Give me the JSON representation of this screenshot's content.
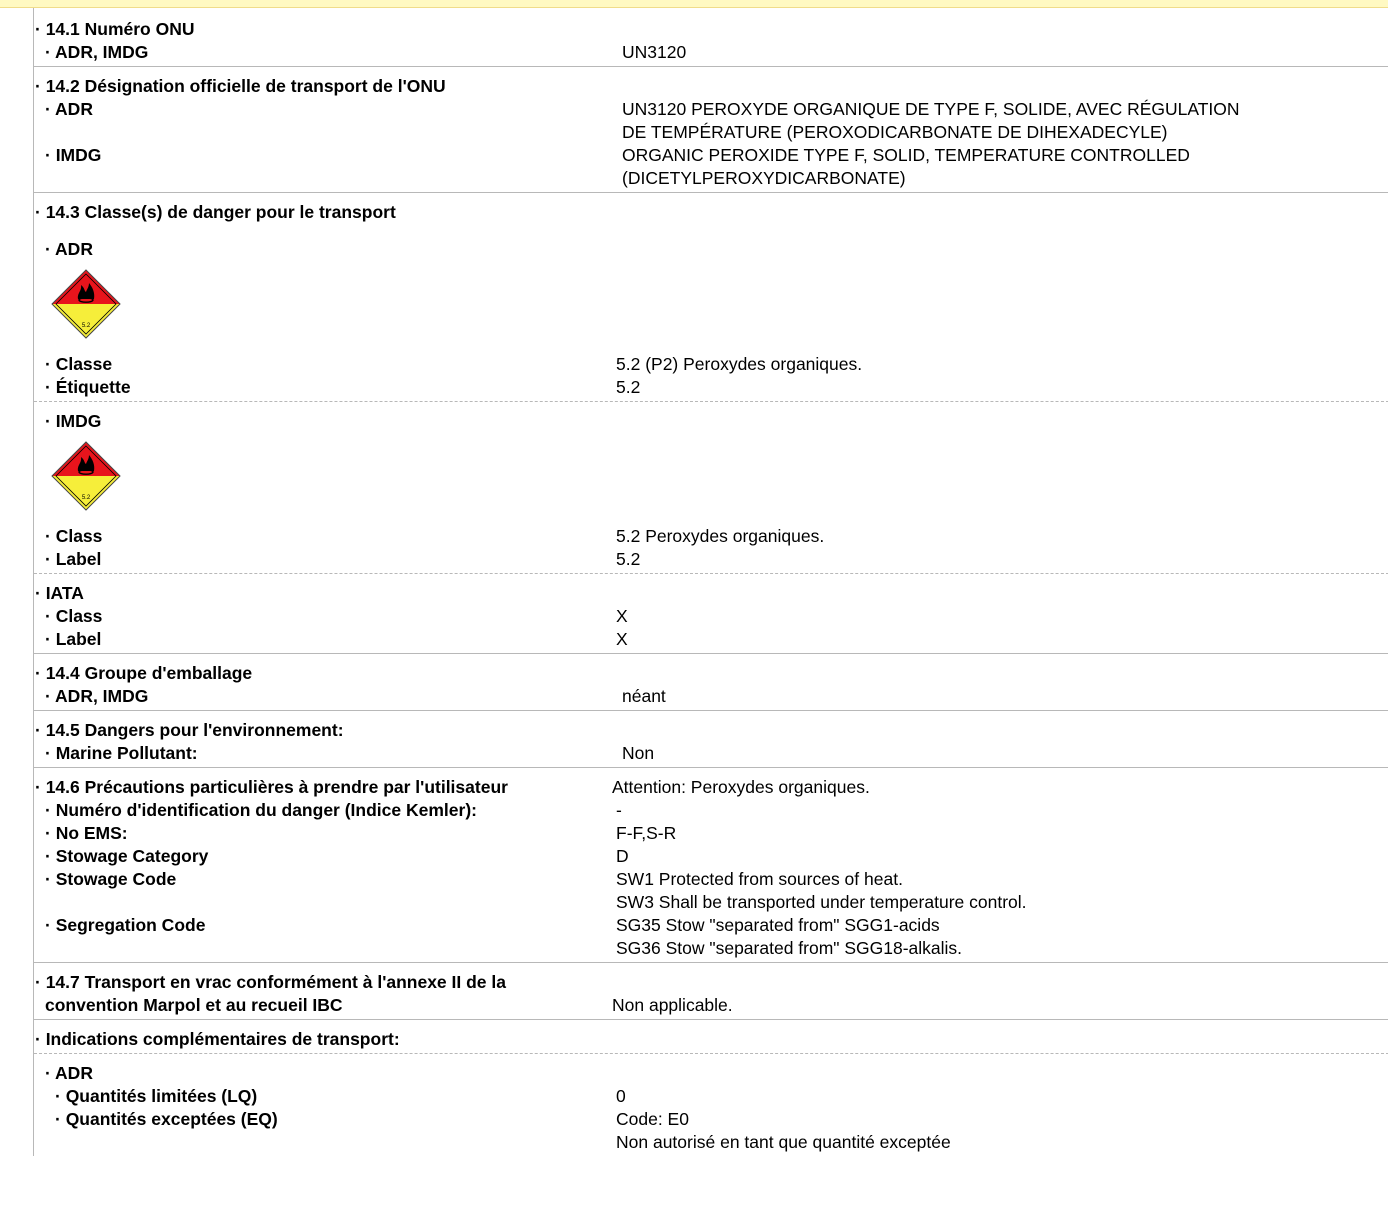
{
  "s1": {
    "title": "· 14.1 Numéro ONU",
    "label": "· ADR, IMDG",
    "value": "UN3120"
  },
  "s2": {
    "title": "· 14.2 Désignation officielle de transport de l'ONU",
    "adr_label": "· ADR",
    "adr_line1": "UN3120 PEROXYDE ORGANIQUE DE TYPE F, SOLIDE, AVEC RÉGULATION",
    "adr_line2": "DE TEMPÉRATURE (PEROXODICARBONATE DE DIHEXADECYLE)",
    "imdg_label": "· IMDG",
    "imdg_line1": "ORGANIC PEROXIDE TYPE F, SOLID, TEMPERATURE CONTROLLED",
    "imdg_line2": "(DICETYLPEROXYDICARBONATE)"
  },
  "s3": {
    "title": "· 14.3 Classe(s) de danger pour le transport",
    "adr": {
      "heading": "· ADR",
      "sign_text": "5.2",
      "class_label": "· Classe",
      "class_value": "5.2 (P2) Peroxydes organiques.",
      "label_label": "· Étiquette",
      "label_value": "5.2"
    },
    "imdg": {
      "heading": "· IMDG",
      "sign_text": "5.2",
      "class_label": "· Class",
      "class_value": "5.2 Peroxydes organiques.",
      "label_label": "· Label",
      "label_value": "5.2"
    },
    "iata": {
      "heading": "· IATA",
      "class_label": "· Class",
      "class_value": "X",
      "label_label": "· Label",
      "label_value": "X"
    },
    "sign_colors": {
      "top": "#e8141c",
      "bottom": "#f6ee3a",
      "flame": "#000000"
    }
  },
  "s4": {
    "title": "· 14.4 Groupe d'emballage",
    "label": "· ADR, IMDG",
    "value": "néant"
  },
  "s5": {
    "title": "· 14.5 Dangers pour l'environnement:",
    "label": "· Marine Pollutant:",
    "value": "Non"
  },
  "s6": {
    "title": "· 14.6 Précautions particulières à prendre par l'utilisateur",
    "title_value": "Attention: Peroxydes organiques.",
    "kemler_label": "· Numéro d'identification du danger (Indice Kemler):",
    "kemler_value": "-",
    "ems_label": "· No EMS:",
    "ems_value": "F-F,S-R",
    "stowcat_label": "· Stowage Category",
    "stowcat_value": "D",
    "stowcode_label": "· Stowage Code",
    "stowcode_1": "SW1 Protected from sources of heat.",
    "stowcode_2": "SW3 Shall be transported under temperature control.",
    "seg_label": "· Segregation Code",
    "seg_1": "SG35 Stow \"separated from\" SGG1-acids",
    "seg_2": "SG36 Stow \"separated from\" SGG18-alkalis."
  },
  "s7": {
    "title_1": "· 14.7 Transport en vrac conformément à l'annexe II de la",
    "title_2": "convention Marpol et au recueil IBC",
    "value": "Non applicable."
  },
  "extra": {
    "title": "· Indications complémentaires de transport:",
    "adr_heading": "· ADR",
    "lq_label": "· Quantités limitées (LQ)",
    "lq_value": "0",
    "eq_label": "· Quantités exceptées (EQ)",
    "eq_1": "Code: E0",
    "eq_2": "Non autorisé en tant que quantité exceptée"
  }
}
